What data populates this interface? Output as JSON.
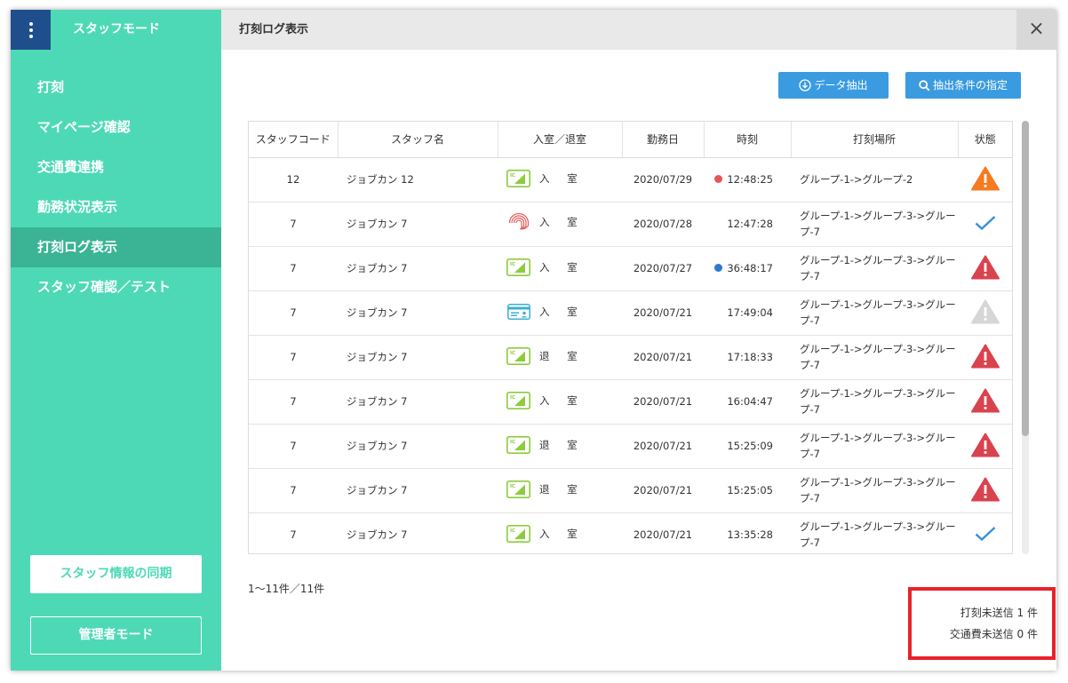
{
  "sidebar": {
    "mode_title": "スタッフモード",
    "nav": [
      {
        "label": "打刻"
      },
      {
        "label": "マイページ確認"
      },
      {
        "label": "交通費連携"
      },
      {
        "label": "勤務状況表示"
      },
      {
        "label": "打刻ログ表示",
        "active": true
      },
      {
        "label": "スタッフ確認／テスト"
      }
    ],
    "sync_button": "スタッフ情報の同期",
    "admin_button": "管理者モード"
  },
  "header": {
    "title": "打刻ログ表示",
    "close": "×"
  },
  "toolbar": {
    "extract_label": "データ抽出",
    "condition_label": "抽出条件の指定"
  },
  "table": {
    "columns": [
      "スタッフコード",
      "スタッフ名",
      "入室／退室",
      "勤務日",
      "時刻",
      "打刻場所",
      "状態"
    ],
    "rows": [
      {
        "code": "12",
        "name": "ジョブカン 12",
        "method": "ic",
        "io": "入 室",
        "date": "2020/07/29",
        "dot": "red",
        "time": "12:48:25",
        "place": "グループ-1->グループ-2",
        "status": "warning-orange"
      },
      {
        "code": "7",
        "name": "ジョブカン 7",
        "method": "fingerprint",
        "io": "入 室",
        "date": "2020/07/28",
        "dot": "",
        "time": "12:47:28",
        "place": "グループ-1->グループ-3->グループ-7",
        "status": "check"
      },
      {
        "code": "7",
        "name": "ジョブカン 7",
        "method": "ic",
        "io": "入 室",
        "date": "2020/07/27",
        "dot": "blue",
        "time": "36:48:17",
        "place": "グループ-1->グループ-3->グループ-7",
        "status": "warning-red"
      },
      {
        "code": "7",
        "name": "ジョブカン 7",
        "method": "card",
        "io": "入 室",
        "date": "2020/07/21",
        "dot": "",
        "time": "17:49:04",
        "place": "グループ-1->グループ-3->グループ-7",
        "status": "warning-gray"
      },
      {
        "code": "7",
        "name": "ジョブカン 7",
        "method": "ic",
        "io": "退 室",
        "date": "2020/07/21",
        "dot": "",
        "time": "17:18:33",
        "place": "グループ-1->グループ-3->グループ-7",
        "status": "warning-red"
      },
      {
        "code": "7",
        "name": "ジョブカン 7",
        "method": "ic",
        "io": "入 室",
        "date": "2020/07/21",
        "dot": "",
        "time": "16:04:47",
        "place": "グループ-1->グループ-3->グループ-7",
        "status": "warning-red"
      },
      {
        "code": "7",
        "name": "ジョブカン 7",
        "method": "ic",
        "io": "退 室",
        "date": "2020/07/21",
        "dot": "",
        "time": "15:25:09",
        "place": "グループ-1->グループ-3->グループ-7",
        "status": "warning-red"
      },
      {
        "code": "7",
        "name": "ジョブカン 7",
        "method": "ic",
        "io": "退 室",
        "date": "2020/07/21",
        "dot": "",
        "time": "15:25:05",
        "place": "グループ-1->グループ-3->グループ-7",
        "status": "warning-red"
      },
      {
        "code": "7",
        "name": "ジョブカン 7",
        "method": "ic",
        "io": "入 室",
        "date": "2020/07/21",
        "dot": "",
        "time": "13:35:28",
        "place": "グループ-1->グループ-3->グループ-7",
        "status": "check"
      }
    ]
  },
  "pagination": {
    "count_text": "1〜11件／11件"
  },
  "unsent": {
    "stamp_text": "打刻未送信 1 件",
    "travel_text": "交通費未送信 0 件"
  },
  "colors": {
    "sidebar": "#4dd9b6",
    "sidebar_active": "#3ab495",
    "menu_button": "#1e4f8c",
    "primary_button": "#3a9be0",
    "warning_orange": "#f47b20",
    "warning_red": "#d9434e",
    "warning_gray": "#d6d6d6",
    "check": "#3a8fd6",
    "highlight_box": "#e8222a"
  }
}
